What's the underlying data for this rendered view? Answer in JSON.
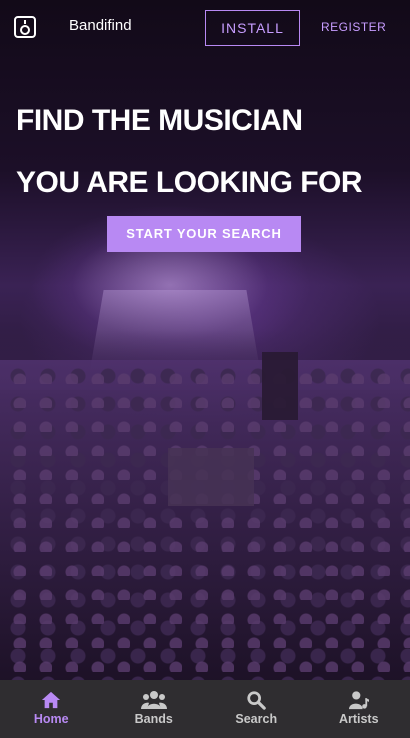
{
  "header": {
    "brand": "Bandifind",
    "install_label": "INSTALL",
    "register_label": "REGISTER"
  },
  "hero": {
    "title_line1": "FIND THE MUSICIAN",
    "title_line2": "YOU ARE LOOKING FOR",
    "cta_label": "START YOUR SEARCH"
  },
  "nav": {
    "items": [
      {
        "label": "Home",
        "icon": "home-icon",
        "active": true
      },
      {
        "label": "Bands",
        "icon": "group-icon",
        "active": false
      },
      {
        "label": "Search",
        "icon": "search-icon",
        "active": false
      },
      {
        "label": "Artists",
        "icon": "artist-icon",
        "active": false
      }
    ]
  },
  "colors": {
    "accent": "#b889f3",
    "nav_background": "#2f2d30",
    "nav_inactive": "#c9c9c9"
  }
}
